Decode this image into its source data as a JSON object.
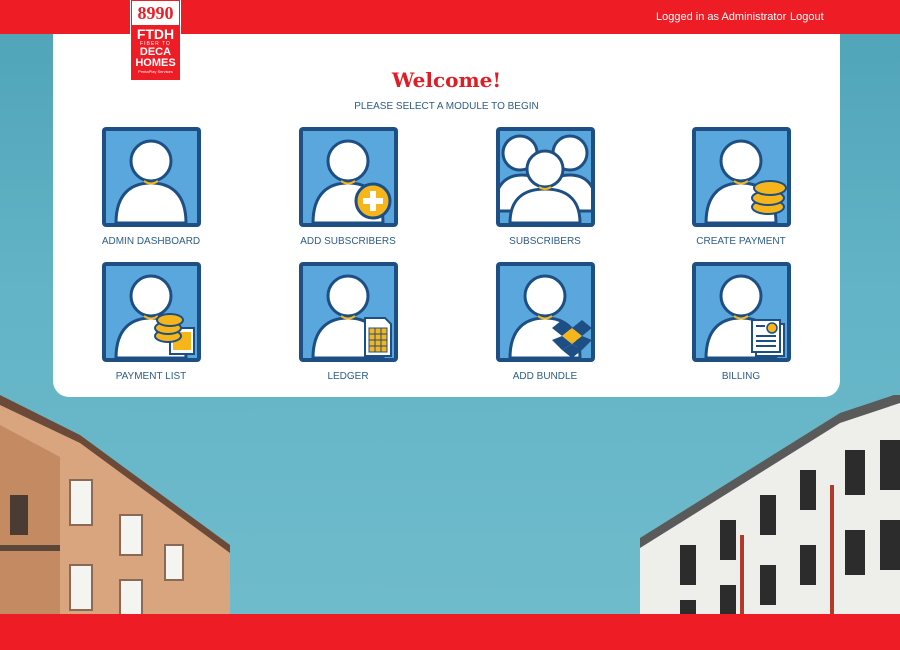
{
  "header": {
    "user_text": "Logged in as Administrator",
    "logout_label": "Logout"
  },
  "logo": {
    "number": "8990",
    "line1": "FTDH",
    "line2": "FIBER TO",
    "line3": "DECA",
    "line4": "HOMES",
    "line5": "PentaPlay Services"
  },
  "main": {
    "welcome": "Welcome!",
    "subtitle": "PLEASE SELECT A MODULE TO BEGIN"
  },
  "modules": [
    {
      "label": "ADMIN DASHBOARD",
      "icon": "user-icon"
    },
    {
      "label": "ADD SUBSCRIBERS",
      "icon": "add-user-icon"
    },
    {
      "label": "SUBSCRIBERS",
      "icon": "users-group-icon"
    },
    {
      "label": "CREATE PAYMENT",
      "icon": "user-coins-icon"
    },
    {
      "label": "PAYMENT LIST",
      "icon": "user-coins-calculator-icon"
    },
    {
      "label": "LEDGER",
      "icon": "user-spreadsheet-icon"
    },
    {
      "label": "ADD BUNDLE",
      "icon": "user-boxes-icon"
    },
    {
      "label": "BILLING",
      "icon": "user-bill-icon"
    }
  ],
  "colors": {
    "brand_red": "#ee1c25",
    "tile_border": "#1d4f84",
    "tile_fill": "#5aa7dd",
    "text_blue": "#2d5c86"
  }
}
